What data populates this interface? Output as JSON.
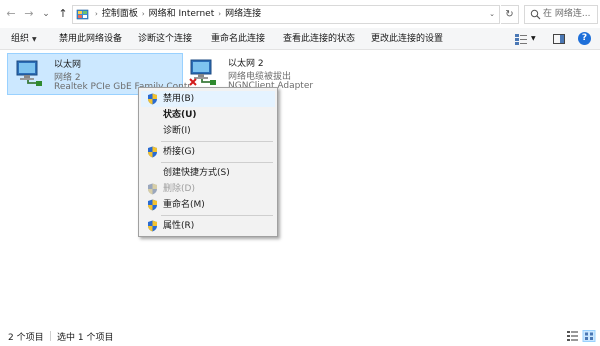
{
  "address_bar": {
    "back_glyph": "←",
    "forward_glyph": "→",
    "recent_glyph": "⌄",
    "up_glyph": "↑",
    "breadcrumbs": [
      "控制面板",
      "网络和 Internet",
      "网络连接"
    ],
    "breadcrumb_separator": "›",
    "dropdown_glyph": "⌄",
    "refresh_glyph": "↻",
    "search_placeholder": "在 网络连..."
  },
  "toolbar": {
    "organize": "组织",
    "organize_caret": "▼",
    "disable_device": "禁用此网络设备",
    "diagnose": "诊断这个连接",
    "rename": "重命名此连接",
    "view_status": "查看此连接的状态",
    "change_settings": "更改此连接的设置",
    "view_caret": "▼",
    "help_glyph": "?"
  },
  "adapters": [
    {
      "name": "以太网",
      "network": "网络 2",
      "device": "Realtek PCIe GbE Family Contr..."
    },
    {
      "name": "以太网 2",
      "network": "网络电缆被拔出",
      "device": "NGNClient Adapter"
    }
  ],
  "context_menu": {
    "items": [
      {
        "label": "禁用(B)",
        "shield": true
      },
      {
        "label": "状态(U)",
        "shield": false,
        "bold": true
      },
      {
        "label": "诊断(I)",
        "shield": false
      },
      {
        "label": "桥接(G)",
        "shield": true
      },
      {
        "label": "创建快捷方式(S)",
        "shield": false
      },
      {
        "label": "删除(D)",
        "shield": true,
        "disabled": true
      },
      {
        "label": "重命名(M)",
        "shield": true
      },
      {
        "label": "属性(R)",
        "shield": true
      }
    ]
  },
  "statusbar": {
    "item_count": "2 个项目",
    "selected_count": "选中 1 个项目"
  },
  "colors": {
    "selection_bg": "#cce8ff",
    "selection_border": "#99d1ff",
    "help_blue": "#1e6fd9",
    "error_red": "#d21a1a"
  }
}
